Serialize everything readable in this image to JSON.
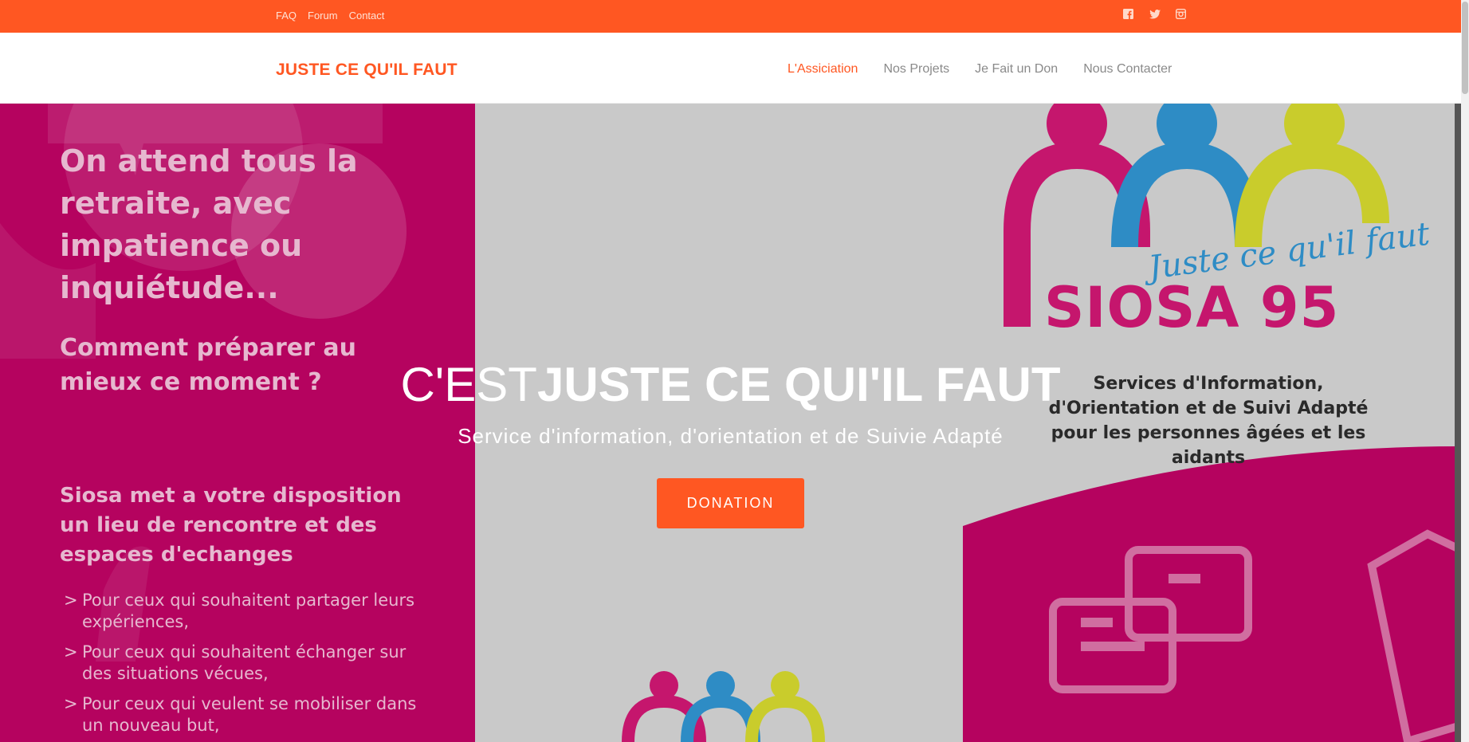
{
  "topbar": {
    "links": [
      "FAQ",
      "Forum",
      "Contact"
    ],
    "social_icons": [
      "facebook-icon",
      "twitter-icon",
      "instagram-icon"
    ],
    "color": "#ff5722"
  },
  "navbar": {
    "brand": "JUSTE CE QU'IL FAUT",
    "menu": [
      {
        "label": "L'Assiciation",
        "active": true
      },
      {
        "label": "Nos Projets",
        "active": false
      },
      {
        "label": "Je Fait un Don",
        "active": false
      },
      {
        "label": "Nous Contacter",
        "active": false
      }
    ]
  },
  "hero": {
    "title_prefix": "C'EST",
    "title_main": "JUSTE CE QUI'IL FAUT",
    "subtitle": "Service d'information, d'orientation et de Suivie Adapté",
    "button_label": "DONATION",
    "flyer": {
      "heading": "On attend tous la retraite, avec impatience ou inquiétude...",
      "question": "Comment préparer au mieux ce moment ?",
      "offer": "Siosa met a votre disposition un lieu de rencontre et des espaces d'echanges",
      "list": [
        "Pour ceux qui souhaitent partager leurs expériences,",
        "Pour ceux qui souhaitent échanger sur des situations vécues,",
        "Pour ceux qui veulent se mobiliser dans un nouveau but,"
      ],
      "logo_script": "Juste ce qu'il faut",
      "logo_title": "SIOSA 95",
      "logo_desc": "Services d'Information, d'Orientation et de Suivi Adapté pour les personnes âgées et les aidants",
      "colors": {
        "magenta": "#c5166d",
        "blue": "#2e8cc5",
        "yellow": "#c9cc2c",
        "panel": "#b5035f"
      }
    }
  }
}
